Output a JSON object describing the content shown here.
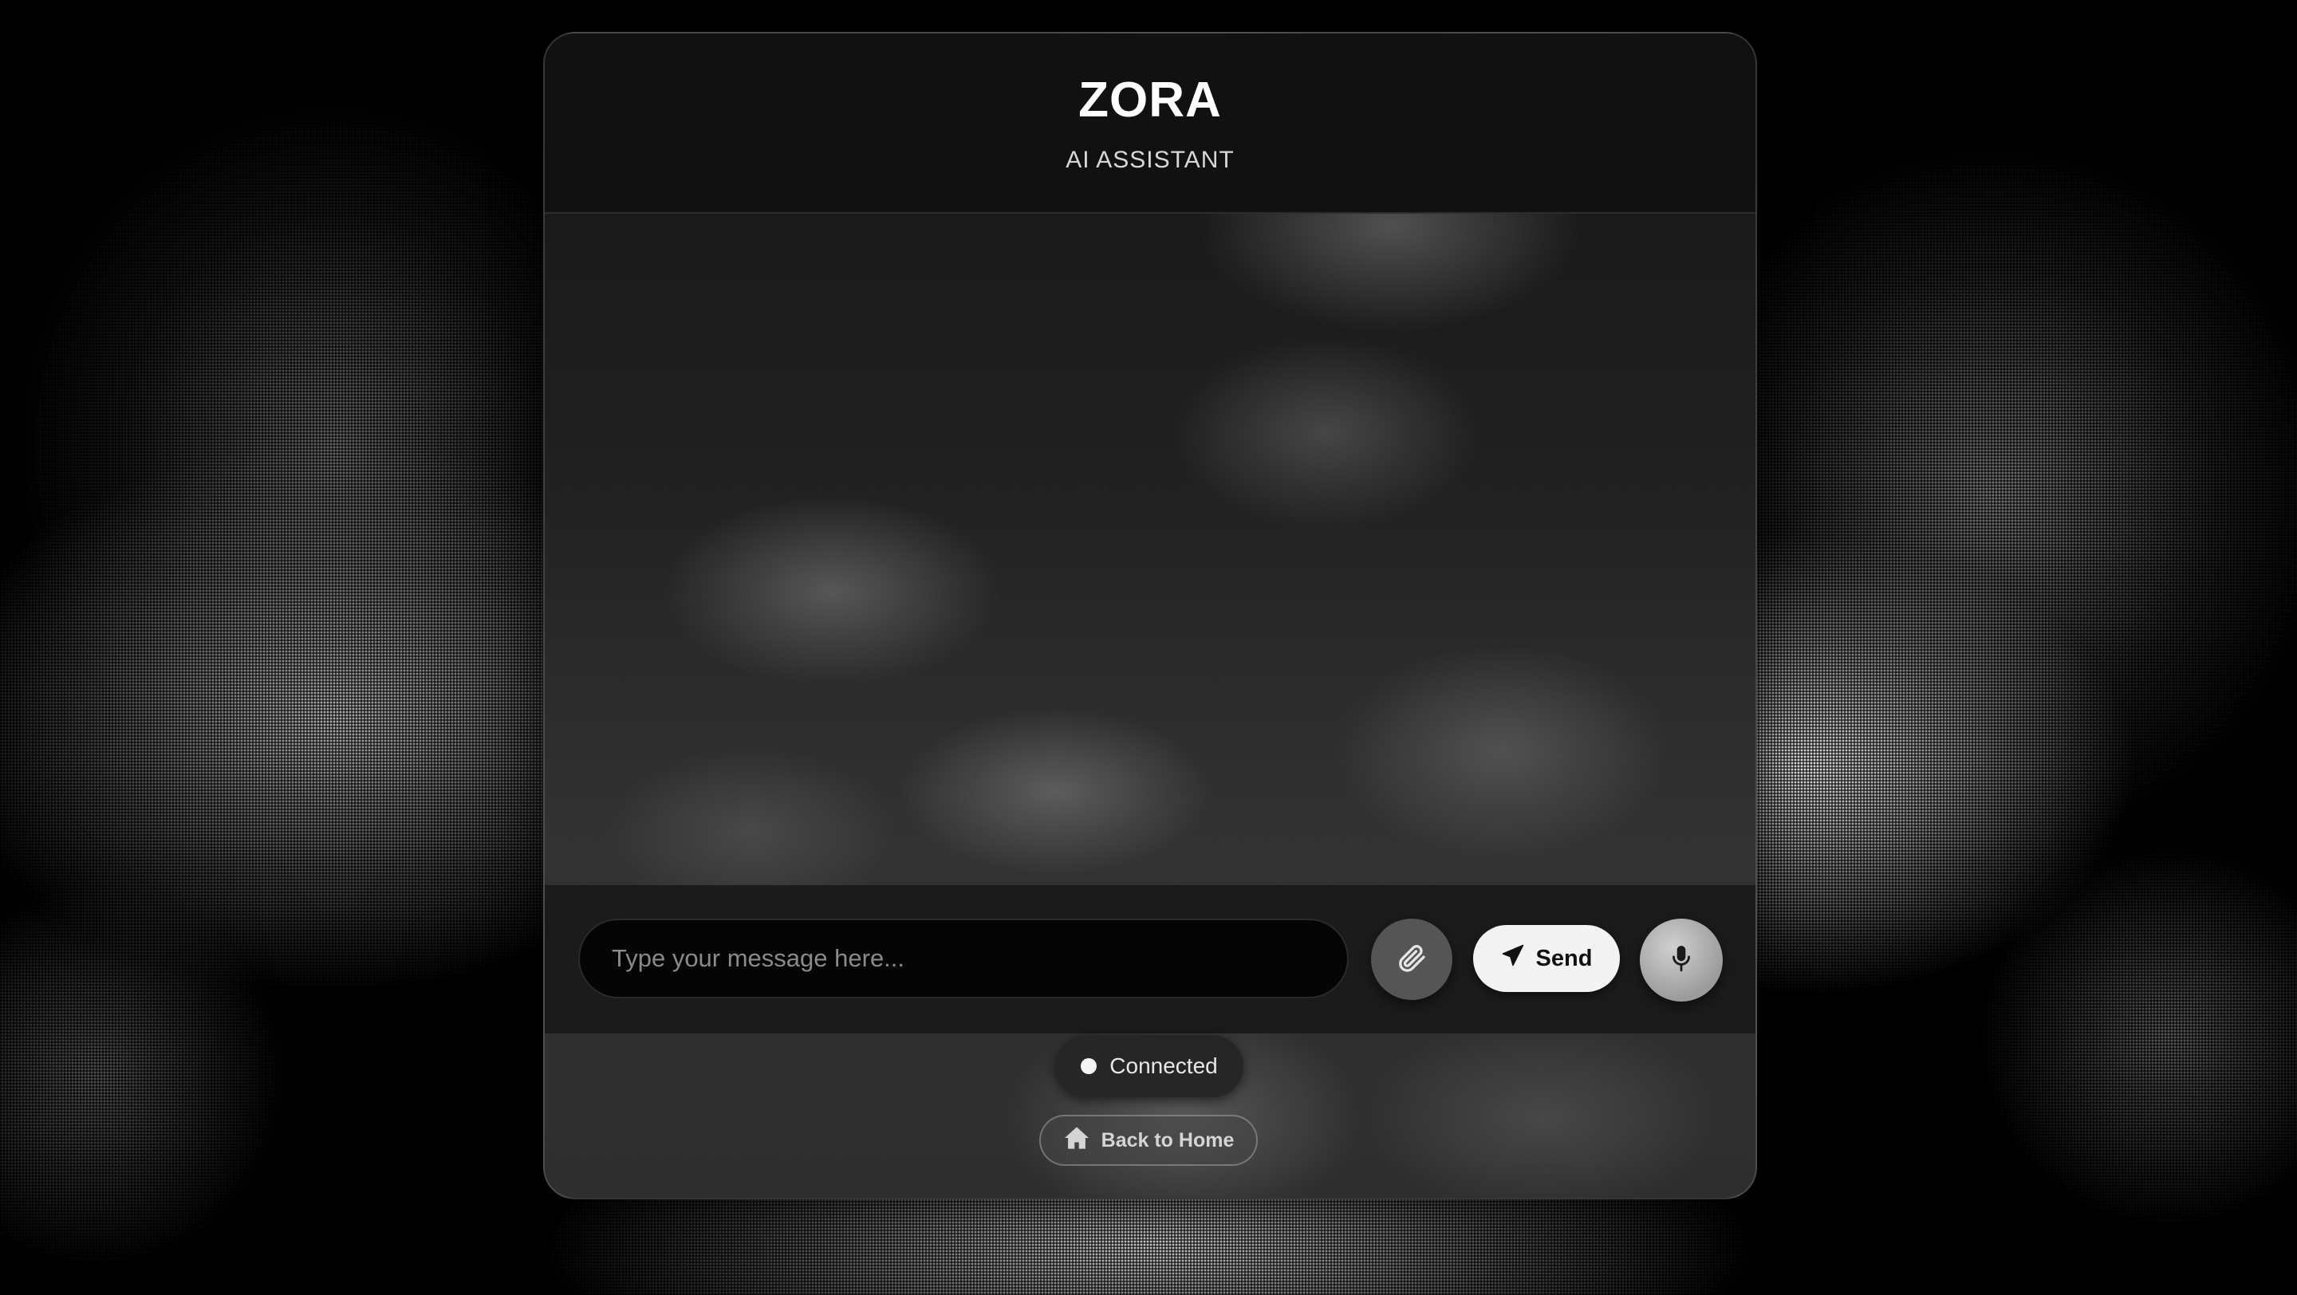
{
  "header": {
    "title": "ZORA",
    "subtitle": "AI ASSISTANT"
  },
  "composer": {
    "placeholder": "Type your message here...",
    "value": "",
    "attach_icon": "paperclip-icon",
    "send_label": "Send",
    "send_icon": "paper-plane-icon",
    "mic_icon": "microphone-icon"
  },
  "status": {
    "label": "Connected",
    "dot_color": "#f5f5f5"
  },
  "nav": {
    "home_label": "Back to Home",
    "home_icon": "home-icon"
  },
  "theme": {
    "background": "#000000",
    "card": "#111111",
    "accent": "#f3f3f3"
  }
}
